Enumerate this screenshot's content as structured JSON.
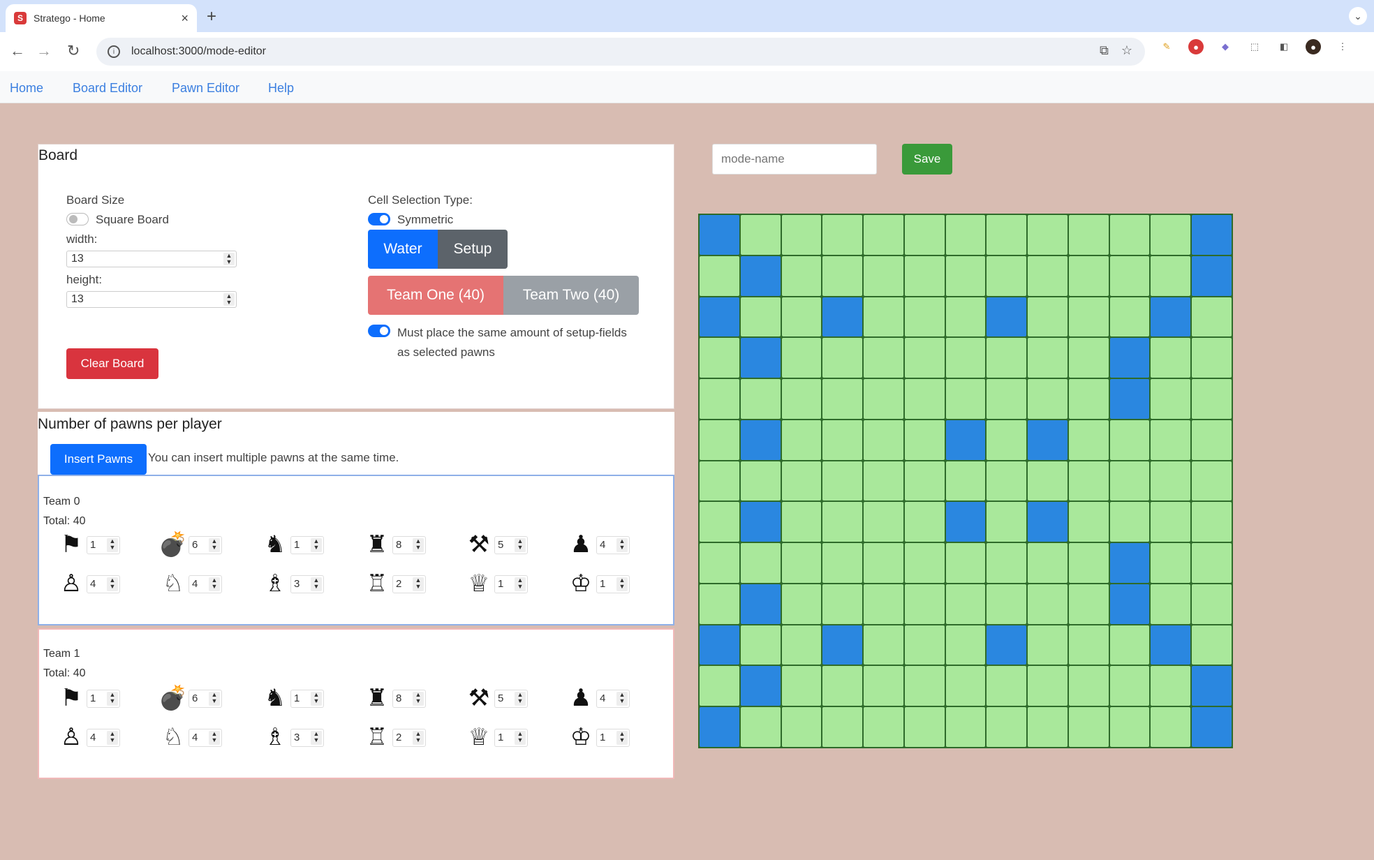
{
  "browser": {
    "tab_title": "Stratego - Home",
    "url": "localhost:3000/mode-editor"
  },
  "app_nav": [
    "Home",
    "Board Editor",
    "Pawn Editor",
    "Help"
  ],
  "board_panel": {
    "title": "Board",
    "board_size_label": "Board Size",
    "square_board_label": "Square Board",
    "square_board_on": false,
    "width_label": "width:",
    "width_value": "13",
    "height_label": "height:",
    "height_value": "13",
    "clear_button": "Clear Board",
    "cell_selection_label": "Cell Selection Type:",
    "symmetric_label": "Symmetric",
    "symmetric_on": true,
    "water_button": "Water",
    "setup_button": "Setup",
    "team_one_button": "Team One (40)",
    "team_two_button": "Team Two (40)",
    "same_amount_label": "Must place the same amount of setup-fields as selected pawns",
    "same_amount_on": true
  },
  "pawns_panel": {
    "title": "Number of pawns per player",
    "insert_button": "Insert Pawns",
    "hint": "You can insert multiple pawns at the same time.",
    "teams": [
      {
        "name": "Team 0",
        "total": "Total: 40",
        "pawns": [
          {
            "icon": "flag-icon",
            "count": "1"
          },
          {
            "icon": "bomb-icon",
            "count": "6"
          },
          {
            "icon": "spy-icon",
            "count": "1"
          },
          {
            "icon": "scout-icon",
            "count": "8"
          },
          {
            "icon": "miner-icon",
            "count": "5"
          },
          {
            "icon": "sergeant-icon",
            "count": "4"
          },
          {
            "icon": "lieutenant-icon",
            "count": "4"
          },
          {
            "icon": "captain-icon",
            "count": "4"
          },
          {
            "icon": "major-icon",
            "count": "3"
          },
          {
            "icon": "colonel-icon",
            "count": "2"
          },
          {
            "icon": "general-icon",
            "count": "1"
          },
          {
            "icon": "marshal-icon",
            "count": "1"
          }
        ]
      },
      {
        "name": "Team 1",
        "total": "Total: 40",
        "pawns": [
          {
            "icon": "flag-icon",
            "count": "1"
          },
          {
            "icon": "bomb-icon",
            "count": "6"
          },
          {
            "icon": "spy-icon",
            "count": "1"
          },
          {
            "icon": "scout-icon",
            "count": "8"
          },
          {
            "icon": "miner-icon",
            "count": "5"
          },
          {
            "icon": "sergeant-icon",
            "count": "4"
          },
          {
            "icon": "lieutenant-icon",
            "count": "4"
          },
          {
            "icon": "captain-icon",
            "count": "4"
          },
          {
            "icon": "major-icon",
            "count": "3"
          },
          {
            "icon": "colonel-icon",
            "count": "2"
          },
          {
            "icon": "general-icon",
            "count": "1"
          },
          {
            "icon": "marshal-icon",
            "count": "1"
          }
        ]
      }
    ]
  },
  "mode_editor": {
    "name_placeholder": "mode-name",
    "save_button": "Save"
  },
  "board_grid": {
    "size": 13,
    "water_cells": [
      [
        0,
        0
      ],
      [
        0,
        12
      ],
      [
        1,
        1
      ],
      [
        1,
        12
      ],
      [
        2,
        0
      ],
      [
        2,
        3
      ],
      [
        2,
        7
      ],
      [
        2,
        11
      ],
      [
        3,
        1
      ],
      [
        3,
        10
      ],
      [
        4,
        10
      ],
      [
        5,
        1
      ],
      [
        5,
        6
      ],
      [
        5,
        8
      ],
      [
        7,
        1
      ],
      [
        7,
        6
      ],
      [
        7,
        8
      ],
      [
        8,
        10
      ],
      [
        9,
        1
      ],
      [
        9,
        10
      ],
      [
        10,
        0
      ],
      [
        10,
        3
      ],
      [
        10,
        7
      ],
      [
        10,
        11
      ],
      [
        11,
        1
      ],
      [
        11,
        12
      ],
      [
        12,
        0
      ],
      [
        12,
        12
      ]
    ]
  },
  "colors": {
    "page_bg": "#d8bcb2",
    "land": "#a9e89b",
    "water": "#2a87e0",
    "primary": "#0d6efd",
    "danger": "#d9343e",
    "team_one": "#e57373",
    "team_two": "#9aa0a6",
    "save": "#3a9a3a"
  }
}
